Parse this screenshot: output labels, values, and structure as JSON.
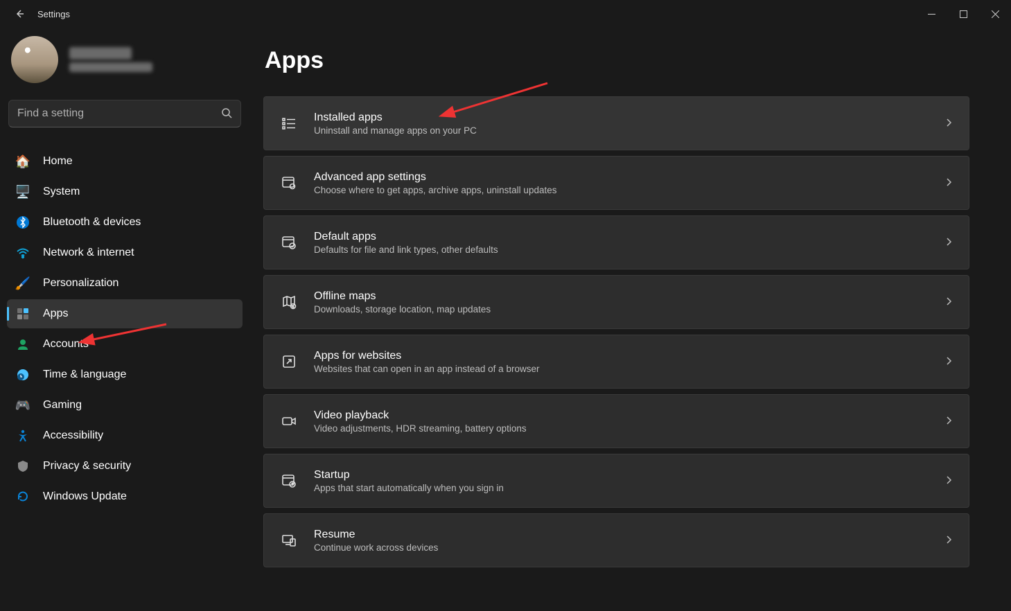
{
  "titlebar": {
    "title": "Settings"
  },
  "search": {
    "placeholder": "Find a setting"
  },
  "nav": {
    "items": [
      {
        "label": "Home"
      },
      {
        "label": "System"
      },
      {
        "label": "Bluetooth & devices"
      },
      {
        "label": "Network & internet"
      },
      {
        "label": "Personalization"
      },
      {
        "label": "Apps",
        "active": true
      },
      {
        "label": "Accounts"
      },
      {
        "label": "Time & language"
      },
      {
        "label": "Gaming"
      },
      {
        "label": "Accessibility"
      },
      {
        "label": "Privacy & security"
      },
      {
        "label": "Windows Update"
      }
    ]
  },
  "page": {
    "title": "Apps"
  },
  "cards": [
    {
      "title": "Installed apps",
      "desc": "Uninstall and manage apps on your PC",
      "highlight": true
    },
    {
      "title": "Advanced app settings",
      "desc": "Choose where to get apps, archive apps, uninstall updates"
    },
    {
      "title": "Default apps",
      "desc": "Defaults for file and link types, other defaults"
    },
    {
      "title": "Offline maps",
      "desc": "Downloads, storage location, map updates"
    },
    {
      "title": "Apps for websites",
      "desc": "Websites that can open in an app instead of a browser"
    },
    {
      "title": "Video playback",
      "desc": "Video adjustments, HDR streaming, battery options"
    },
    {
      "title": "Startup",
      "desc": "Apps that start automatically when you sign in"
    },
    {
      "title": "Resume",
      "desc": "Continue work across devices"
    }
  ]
}
